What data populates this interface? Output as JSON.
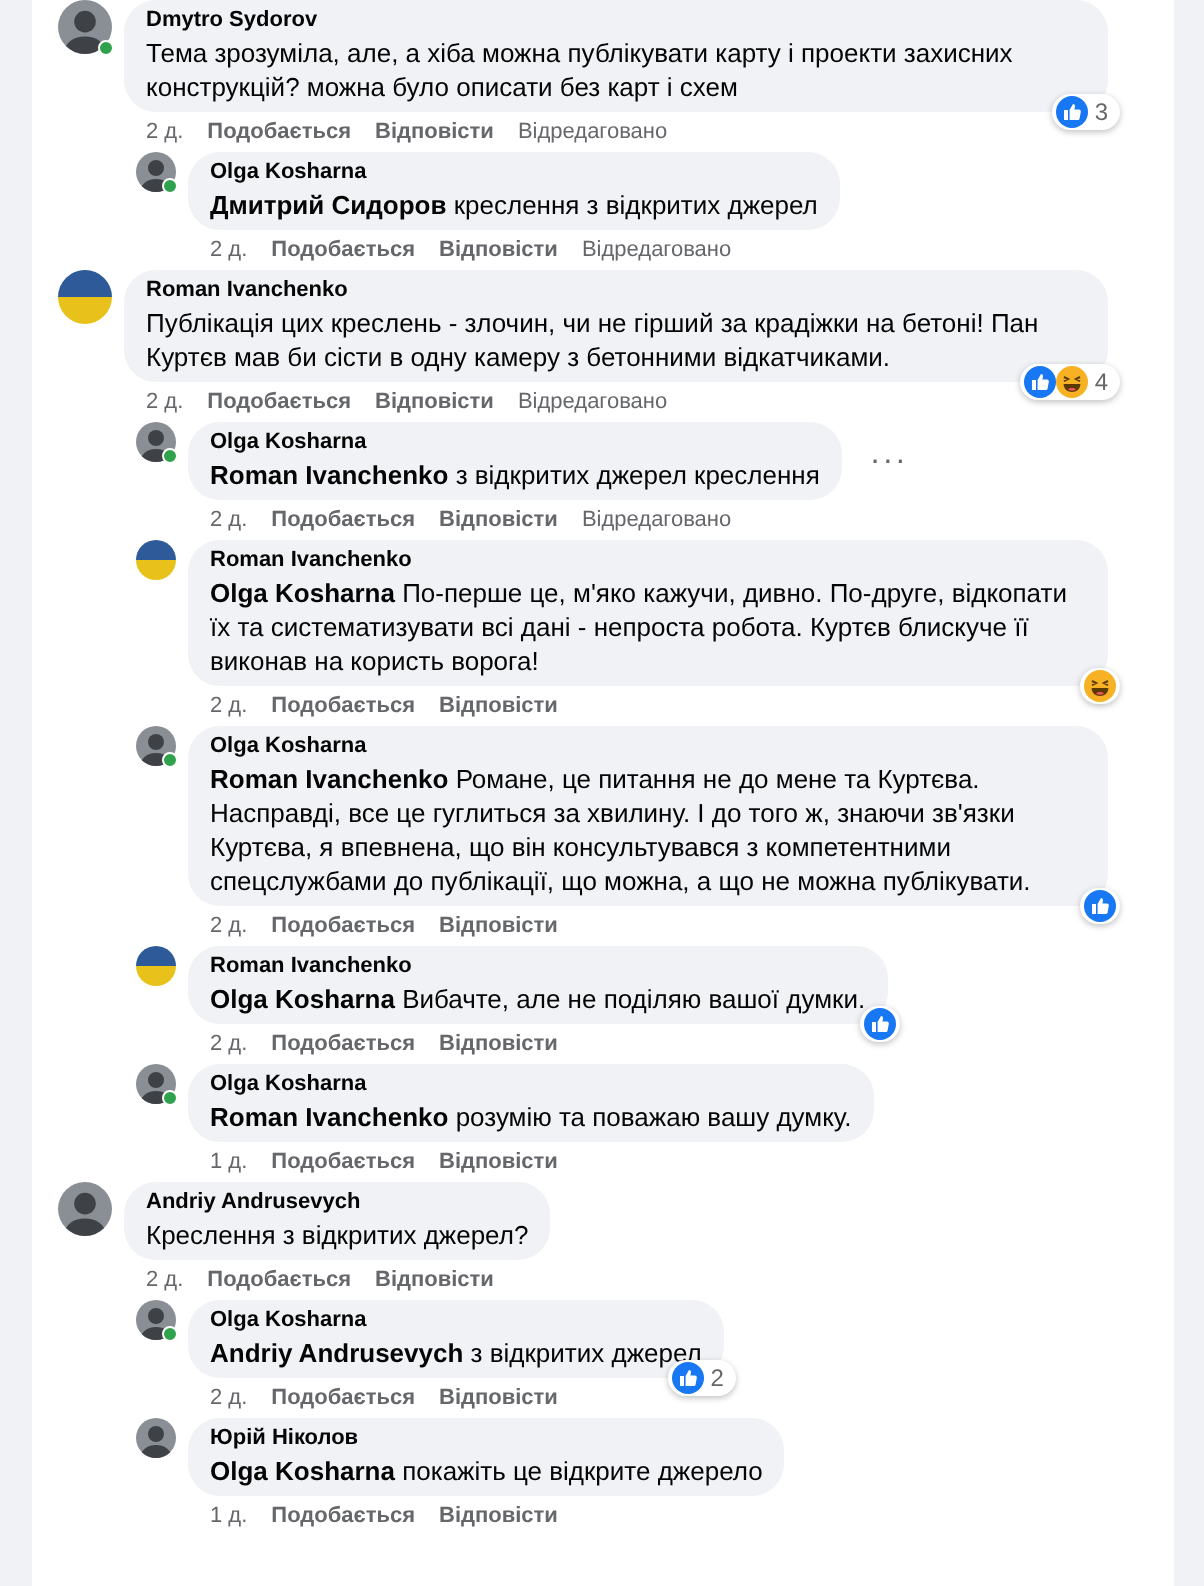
{
  "comments": [
    {
      "author": "Dmytro Sydorov",
      "avatar": {
        "kind": "person"
      },
      "online": true,
      "text": "Тема зрозуміла, але, а хіба можна публікувати карту і проекти захисних конструкцій? можна було описати без карт і схем",
      "time": "2 д.",
      "like": "Подобається",
      "reply": "Відповісти",
      "edited": "Відредаговано",
      "reactions": [
        {
          "kind": "like"
        }
      ],
      "reaction_count": "3",
      "children": [
        {
          "author": "Olga Kosharna",
          "avatar": {
            "kind": "person"
          },
          "online": true,
          "text": "**Дмитрий Сидоров** креслення з відкритих джерел",
          "time": "2 д.",
          "like": "Подобається",
          "reply": "Відповісти",
          "edited": "Відредаговано"
        }
      ]
    },
    {
      "author": "Roman Ivanchenko",
      "avatar": {
        "kind": "flag"
      },
      "text": "Публікація цих креслень - злочин, чи не гірший за крадіжки на бетоні! Пан Куртєв мав би сісти в одну камеру з бетонними відкатчиками.",
      "time": "2 д.",
      "like": "Подобається",
      "reply": "Відповісти",
      "edited": "Відредаговано",
      "reactions": [
        {
          "kind": "like"
        },
        {
          "kind": "haha"
        }
      ],
      "reaction_count": "4",
      "children": [
        {
          "author": "Olga Kosharna",
          "avatar": {
            "kind": "person"
          },
          "online": true,
          "text": "**Roman Ivanchenko** з відкритих джерел креслення",
          "time": "2 д.",
          "like": "Подобається",
          "reply": "Відповісти",
          "edited": "Відредаговано",
          "more_button": "···"
        },
        {
          "author": "Roman Ivanchenko",
          "avatar": {
            "kind": "flag"
          },
          "text": "**Olga Kosharna** По-перше це, м'яко кажучи, дивно. По-друге, відкопати їх та систематизувати всі дані - непроста робота. Куртєв блискуче її виконав на користь ворога!",
          "time": "2 д.",
          "like": "Подобається",
          "reply": "Відповісти",
          "reactions": [
            {
              "kind": "haha"
            }
          ]
        },
        {
          "author": "Olga Kosharna",
          "avatar": {
            "kind": "person"
          },
          "online": true,
          "text": "**Roman Ivanchenko** Романе, це питання не до мене та Куртєва. Насправді, все це гуглиться за хвилину. І до того ж, знаючи зв'язки Куртєва, я впевнена, що він консультувався з компетентними спецслужбами до публікації, що можна, а що не можна публікувати.",
          "time": "2 д.",
          "like": "Подобається",
          "reply": "Відповісти",
          "reactions": [
            {
              "kind": "like"
            }
          ]
        },
        {
          "author": "Roman Ivanchenko",
          "avatar": {
            "kind": "flag"
          },
          "text": "**Olga Kosharna** Вибачте, але не поділяю вашої думки.",
          "time": "2 д.",
          "like": "Подобається",
          "reply": "Відповісти",
          "reactions": [
            {
              "kind": "like"
            }
          ]
        },
        {
          "author": "Olga Kosharna",
          "avatar": {
            "kind": "person"
          },
          "online": true,
          "text": "**Roman Ivanchenko** розумію та поважаю вашу думку.",
          "time": "1 д.",
          "like": "Подобається",
          "reply": "Відповісти"
        }
      ]
    },
    {
      "author": "Andriy Andrusevych",
      "avatar": {
        "kind": "person"
      },
      "text": "Креслення з відкритих джерел?",
      "time": "2 д.",
      "like": "Подобається",
      "reply": "Відповісти",
      "children": [
        {
          "author": "Olga Kosharna",
          "avatar": {
            "kind": "person"
          },
          "online": true,
          "text": "**Andriy Andrusevych** з відкритих джерел",
          "time": "2 д.",
          "like": "Подобається",
          "reply": "Відповісти",
          "reactions": [
            {
              "kind": "like"
            }
          ],
          "reaction_count": "2"
        },
        {
          "author": "Юрій Ніколов",
          "avatar": {
            "kind": "person"
          },
          "text": "**Olga Kosharna** покажіть це відкрите джерело",
          "time": "1 д.",
          "like": "Подобається",
          "reply": "Відповісти"
        }
      ]
    }
  ]
}
